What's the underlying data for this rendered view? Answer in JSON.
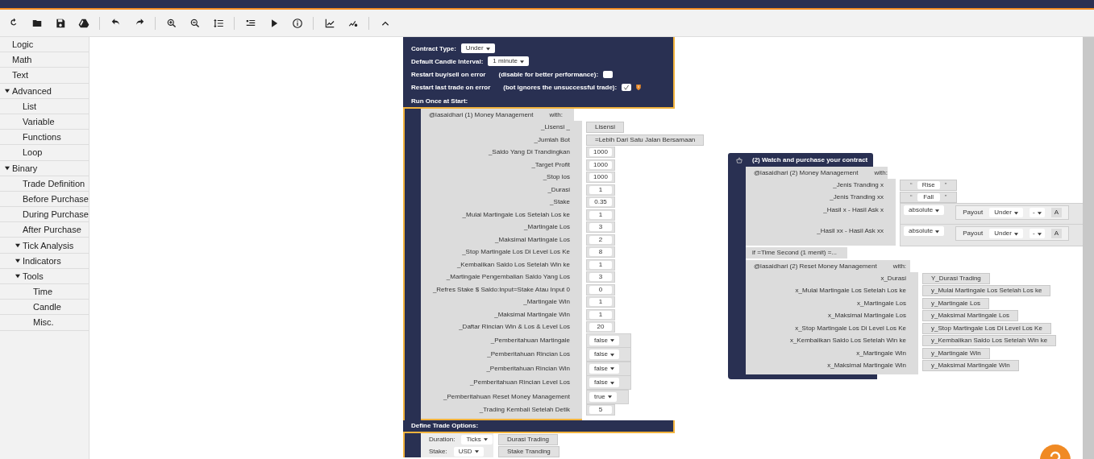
{
  "sidebar": {
    "items": [
      {
        "label": "Logic"
      },
      {
        "label": "Math"
      },
      {
        "label": "Text"
      },
      {
        "label": "Advanced",
        "expanded": true,
        "children": [
          {
            "label": "List"
          },
          {
            "label": "Variable"
          },
          {
            "label": "Functions"
          },
          {
            "label": "Loop"
          }
        ]
      },
      {
        "label": "Binary",
        "expanded": true,
        "children": [
          {
            "label": "Trade Definition"
          },
          {
            "label": "Before Purchase"
          },
          {
            "label": "During Purchase"
          },
          {
            "label": "After Purchase"
          },
          {
            "label": "Tick Analysis",
            "expanded": true
          },
          {
            "label": "Indicators",
            "expanded": true
          },
          {
            "label": "Tools",
            "expanded": true,
            "children": [
              {
                "label": "Time"
              },
              {
                "label": "Candle"
              },
              {
                "label": "Misc."
              }
            ]
          }
        ]
      }
    ]
  },
  "main_block": {
    "settings": [
      {
        "kind": "dropdown",
        "label": "Contract Type:",
        "value": "Under"
      },
      {
        "kind": "dropdown",
        "label": "Default Candle Interval:",
        "value": "1 minute"
      },
      {
        "kind": "checkbox",
        "label": "Restart buy/sell on error",
        "note": "(disable for better performance):",
        "checked": false
      },
      {
        "kind": "checkbox",
        "label": "Restart last trade on error",
        "note": "(bot ignores the unsuccessful trade):",
        "checked": true,
        "warning": true
      }
    ],
    "run_once_label": "Run Once at Start:",
    "procedure": {
      "name": "@lasaidhari (1) Money Management",
      "with": "with:",
      "params": [
        {
          "label": "_Lisensi _",
          "kind": "text",
          "value": "Lisensi"
        },
        {
          "label": "_Jumlah Bot",
          "kind": "text",
          "value": "=Lebih Dari Satu Jalan Bersamaan"
        },
        {
          "label": "_Saldo Yang Di Trandingkan",
          "kind": "number",
          "value": "1000"
        },
        {
          "label": "_Target Profit",
          "kind": "number",
          "value": "1000"
        },
        {
          "label": "_Stop los",
          "kind": "number",
          "value": "1000"
        },
        {
          "label": "_Durasi",
          "kind": "number",
          "value": "1"
        },
        {
          "label": "_Stake",
          "kind": "number",
          "value": "0.35"
        },
        {
          "label": "_Mulai Martingale Los Setelah Los ke",
          "kind": "number",
          "value": "1"
        },
        {
          "label": "_Martingale Los",
          "kind": "number",
          "value": "3"
        },
        {
          "label": "_Maksimal Martingale Los",
          "kind": "number",
          "value": "2"
        },
        {
          "label": "_Stop Martingale Los Di Level Los Ke",
          "kind": "number",
          "value": "8"
        },
        {
          "label": "_Kembalikan Saldo Los Setelah Win ke",
          "kind": "number",
          "value": "1"
        },
        {
          "label": "_Martingale Pengembalian Saldo Yang Los",
          "kind": "number",
          "value": "3"
        },
        {
          "label": "_Refres Stake $ Saldo:Input=Stake Atau Input 0",
          "kind": "number",
          "value": "0"
        },
        {
          "label": "_Martingale Win",
          "kind": "number",
          "value": "1"
        },
        {
          "label": "_Maksimal Martingale Win",
          "kind": "number",
          "value": "1"
        },
        {
          "label": "_Daftar Rincian Win & Los & Level Los",
          "kind": "number",
          "value": "20"
        },
        {
          "label": "_Pemberitahuan Martingale",
          "kind": "dropdown",
          "value": "false"
        },
        {
          "label": "_Pemberitahuan Rincian Los",
          "kind": "dropdown",
          "value": "false"
        },
        {
          "label": "_Pemberitahuan Rincian Win",
          "kind": "dropdown",
          "value": "false"
        },
        {
          "label": "_Pemberitahuan Rincian Level Los",
          "kind": "dropdown",
          "value": "false"
        },
        {
          "label": "_Pemberitahuan Reset Money Management",
          "kind": "dropdown",
          "value": "true"
        },
        {
          "label": "_Trading Kembali Setelah Detik",
          "kind": "number",
          "value": "5"
        }
      ]
    },
    "define_label": "Define Trade Options:",
    "trade_options": [
      {
        "label": "Duration:",
        "dropdown": "Ticks",
        "variable": "Durasi Trading"
      },
      {
        "label": "Stake:",
        "dropdown": "USD",
        "variable": "Stake Tranding"
      }
    ]
  },
  "watch_block": {
    "title": "(2) Watch and purchase your contract",
    "procedure": {
      "name": "@lasaidhari (2)  Money Management",
      "with": "with:",
      "params": [
        {
          "label": "_Jenis Tranding x",
          "kind": "string",
          "open": "“",
          "value": "Rise",
          "close": "”"
        },
        {
          "label": "_Jenis Tranding xx",
          "kind": "string",
          "open": "“",
          "value": "Fall",
          "close": "”"
        },
        {
          "label": "_Hasil x - Hasil Ask x",
          "kind": "math",
          "mode": "absolute",
          "payout_label": "Payout",
          "payout_type": "Under",
          "operator": "-",
          "cut": "A"
        },
        {
          "label": "_Hasil xx - Hasil Ask xx",
          "kind": "math",
          "mode": "absolute",
          "payout_label": "Payout",
          "payout_type": "Under",
          "operator": "-",
          "cut": "A"
        }
      ]
    },
    "condition": "if =Time Second (1 menit) =...",
    "reset": {
      "name": "@lasaidhari (2)  Reset Money Management",
      "with": "with:",
      "params": [
        {
          "label": "x_Durasi",
          "value": "Y_Durasi Trading"
        },
        {
          "label": "x_Mulai Martingale Los Setelah Los ke",
          "value": "y_Mulai Martingale Los Setelah Los ke"
        },
        {
          "label": "x_Martingale Los",
          "value": "y_Martingale Los"
        },
        {
          "label": "x_Maksimal Martingale Los",
          "value": "y_Maksimal Martingale Los"
        },
        {
          "label": "x_Stop Martingale Los Di Level Los Ke",
          "value": "y_Stop Martingale Los Di Level Los Ke"
        },
        {
          "label": "x_Kembalikan Saldo Los Setelah Win ke",
          "value": "y_Kembalikan Saldo Los Setelah Win ke"
        },
        {
          "label": "x_Martingale Win",
          "value": "y_Martingale Win"
        },
        {
          "label": "x_Maksimal Martingale Win",
          "value": "y_Maksimal Martingale Win"
        }
      ]
    }
  }
}
